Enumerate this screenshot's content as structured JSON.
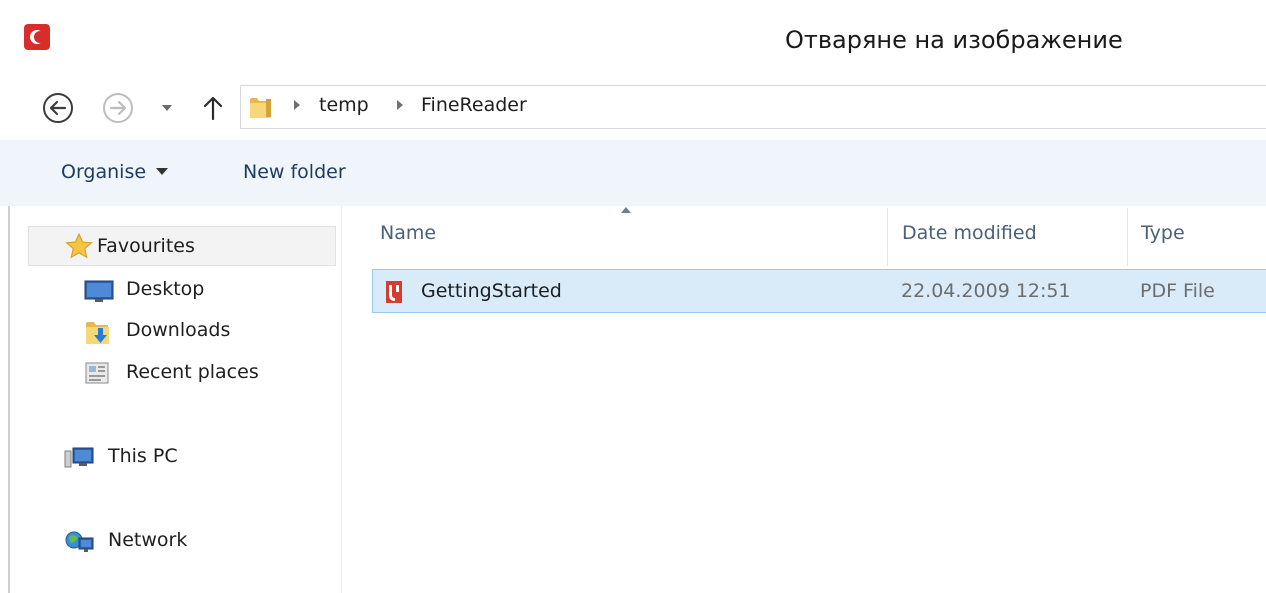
{
  "window": {
    "title": "Отваряне на изображение",
    "accent_color": "#d72d2d"
  },
  "nav": {
    "back_icon": "back-arrow-icon",
    "forward_icon": "forward-arrow-icon",
    "recent_icon": "chevron-down-icon",
    "up_icon": "up-arrow-icon"
  },
  "address": {
    "folder_icon": "folder-icon",
    "breadcrumbs": [
      "temp",
      "FineReader"
    ]
  },
  "toolbar": {
    "organise_label": "Organise",
    "new_folder_label": "New folder"
  },
  "sidebar": {
    "favourites_label": "Favourites",
    "items": [
      {
        "label": "Desktop",
        "icon": "desktop-icon"
      },
      {
        "label": "Downloads",
        "icon": "downloads-folder-icon"
      },
      {
        "label": "Recent places",
        "icon": "recent-places-icon"
      }
    ],
    "this_pc_label": "This PC",
    "network_label": "Network"
  },
  "file_list": {
    "columns": [
      "Name",
      "Date modified",
      "Type"
    ],
    "sort_column": "Name",
    "rows": [
      {
        "name": "GettingStarted",
        "date_modified": "22.04.2009 12:51",
        "type": "PDF File",
        "icon": "pdf-file-icon",
        "selected": true
      }
    ],
    "selection_color": "#d9ebf9"
  }
}
